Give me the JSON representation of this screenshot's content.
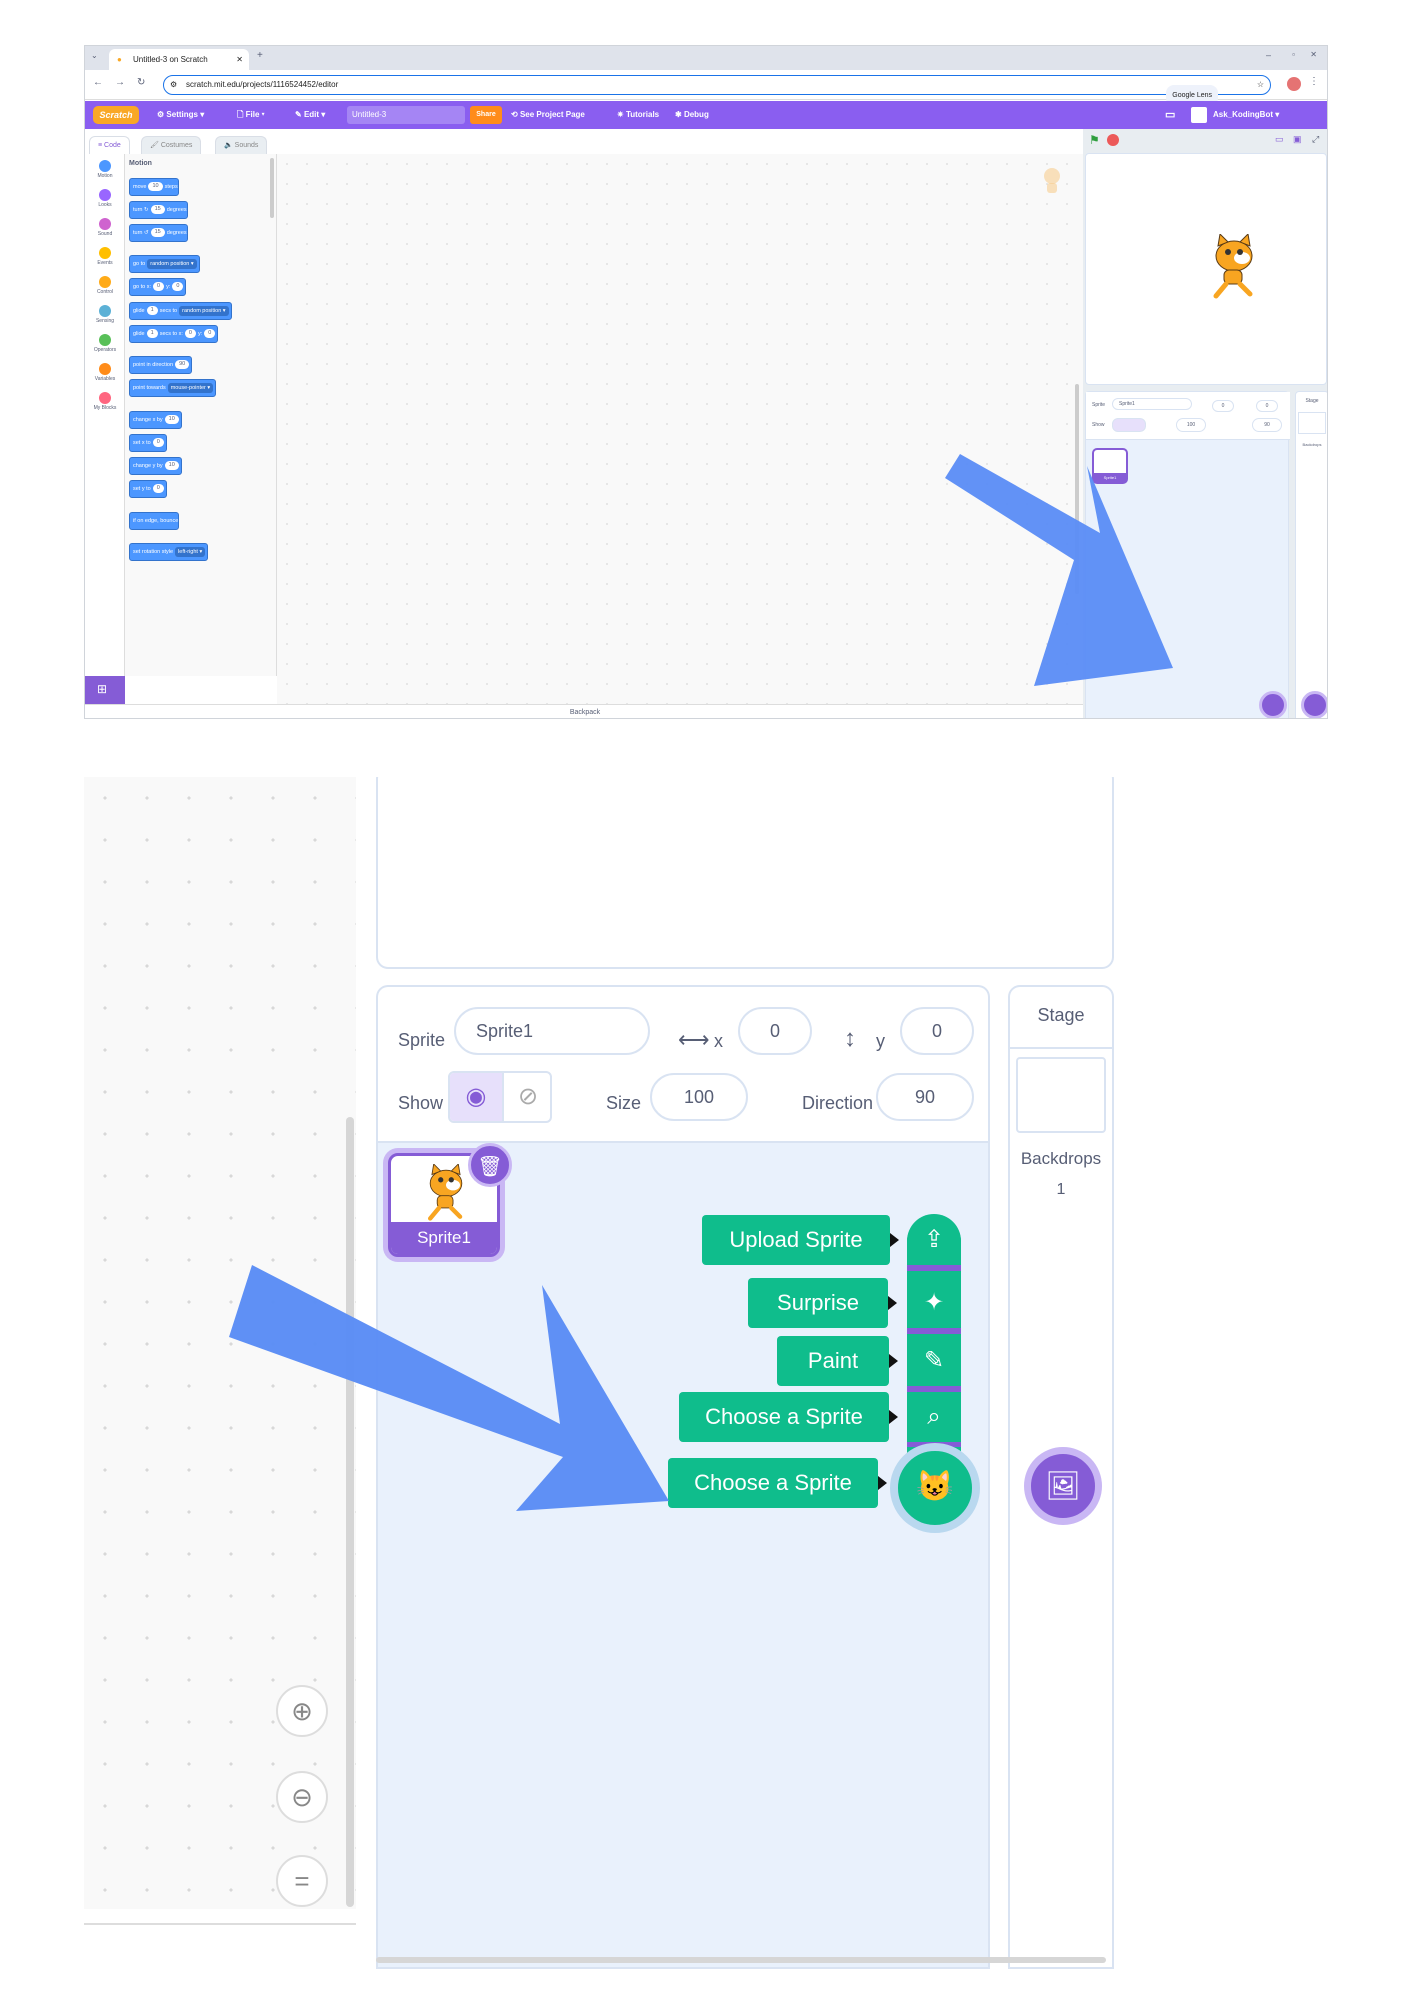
{
  "browser": {
    "tab_title": "Untitled-3 on Scratch",
    "url": "scratch.mit.edu/projects/1116524452/editor",
    "google_lens": "Google Lens"
  },
  "menubar": {
    "logo": "Scratch",
    "settings": "Settings ▾",
    "file": "File ▾",
    "edit": "Edit ▾",
    "project_title": "Untitled-3",
    "share": "Share",
    "see_project_page": "See Project Page",
    "tutorials": "Tutorials",
    "debug": "Debug",
    "user": "Ask_KodingBot ▾"
  },
  "editor_tabs": [
    "Code",
    "Costumes",
    "Sounds"
  ],
  "categories": [
    {
      "name": "Motion",
      "color": "#4c97ff"
    },
    {
      "name": "Looks",
      "color": "#9966ff"
    },
    {
      "name": "Sound",
      "color": "#cf63cf"
    },
    {
      "name": "Events",
      "color": "#ffbf00"
    },
    {
      "name": "Control",
      "color": "#ffab19"
    },
    {
      "name": "Sensing",
      "color": "#5cb1d6"
    },
    {
      "name": "Operators",
      "color": "#59c059"
    },
    {
      "name": "Variables",
      "color": "#ff8c1a"
    },
    {
      "name": "My Blocks",
      "color": "#ff6680"
    }
  ],
  "palette": {
    "heading": "Motion",
    "blocks": {
      "move": {
        "a": "move",
        "v": "10",
        "b": "steps"
      },
      "turn_right": {
        "a": "turn ↻",
        "v": "15",
        "b": "degrees"
      },
      "turn_left": {
        "a": "turn ↺",
        "v": "15",
        "b": "degrees"
      },
      "go_to": {
        "a": "go to",
        "d": "random position ▾"
      },
      "go_to_xy": {
        "a": "go to x:",
        "v": "0",
        "b": "y:",
        "v2": "0"
      },
      "glide_to": {
        "a": "glide",
        "v": "1",
        "b": "secs to",
        "d": "random position ▾"
      },
      "glide_xy": {
        "a": "glide",
        "v": "1",
        "b": "secs to x:",
        "v2": "0",
        "c": "y:",
        "v3": "0"
      },
      "point_dir": {
        "a": "point in direction",
        "v": "90"
      },
      "point_towards": {
        "a": "point towards",
        "d": "mouse-pointer ▾"
      },
      "change_x": {
        "a": "change x by",
        "v": "10"
      },
      "set_x": {
        "a": "set x to",
        "v": "0"
      },
      "change_y": {
        "a": "change y by",
        "v": "10"
      },
      "set_y": {
        "a": "set y to",
        "v": "0"
      },
      "bounce": {
        "a": "if on edge, bounce"
      },
      "rotation": {
        "a": "set rotation style",
        "d": "left-right ▾"
      }
    }
  },
  "backpack": "Backpack",
  "sprite_info": {
    "sprite_label": "Sprite",
    "sprite_name": "Sprite1",
    "x_label": "x",
    "x_value": "0",
    "y_label": "y",
    "y_value": "0",
    "show_label": "Show",
    "size_label": "Size",
    "size_value": "100",
    "direction_label": "Direction",
    "direction_value": "90"
  },
  "sprite_tile": "Sprite1",
  "stage_panel": {
    "title": "Stage",
    "backdrops_label": "Backdrops",
    "backdrops_count": "1"
  },
  "sprite_menu": [
    {
      "label": "Upload Sprite",
      "icon": "upload-icon"
    },
    {
      "label": "Surprise",
      "icon": "sparkle-icon"
    },
    {
      "label": "Paint",
      "icon": "brush-icon"
    },
    {
      "label": "Choose a Sprite",
      "icon": "search-icon"
    },
    {
      "label": "Choose a Sprite",
      "icon": "cat-plus-icon"
    }
  ],
  "colors": {
    "scratch_purple": "#855cd6",
    "menu_bar": "#8a5ef0",
    "motion_blue": "#4c97ff",
    "menu_green": "#0fbd8c",
    "arrow_blue": "#5a8cf5"
  }
}
